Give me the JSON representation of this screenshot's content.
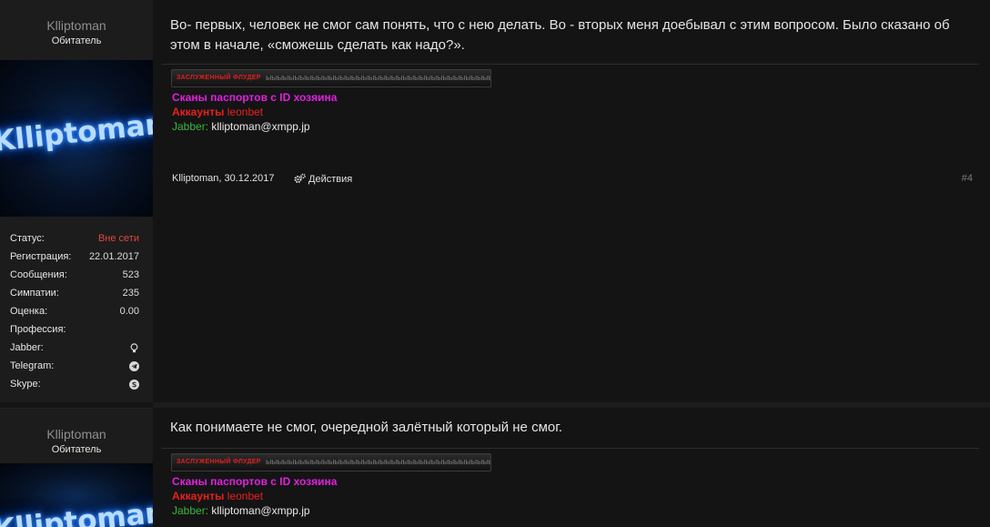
{
  "posts": [
    {
      "author": "Klliptoman",
      "user_title": "Обитатель",
      "avatar_text": "Klliptoman",
      "stats": [
        {
          "label": "Статус:",
          "value": "Вне сети"
        },
        {
          "label": "Регистрация:",
          "value": "22.01.2017"
        },
        {
          "label": "Сообщения:",
          "value": "523"
        },
        {
          "label": "Симпатии:",
          "value": "235"
        },
        {
          "label": "Оценка:",
          "value": "0.00"
        },
        {
          "label": "Профессия:",
          "value": ""
        },
        {
          "label": "Jabber:",
          "icon": "lightbulb-icon"
        },
        {
          "label": "Telegram:",
          "icon": "telegram-icon"
        },
        {
          "label": "Skype:",
          "icon": "skype-icon"
        }
      ],
      "message": "Во- первых, человек не смог сам понять, что с нею делать. Во - вторых меня доебывал с этим вопросом. Было сказано об этом в начале, «сможешь сделать как надо?».",
      "signature": {
        "banner_tag": "ЗАСЛУЖЕННЫЙ ФЛУДЕР",
        "banner_fill": "ыыыыыыыыыыыыыыыыыыыыыыыыыыыыыыыыыыыыыыыыыыыыыыы",
        "line1": "Сканы паспортов с ID хозяина",
        "line2_label": "Аккаунты",
        "line2_link": "leonbet",
        "line3_label": "Jabber:",
        "line3_value": "klliptoman@xmpp.jp"
      },
      "meta": {
        "author_date": "Klliptoman, 30.12.2017",
        "actions_label": "Действия",
        "post_number": "#4"
      }
    },
    {
      "author": "Klliptoman",
      "user_title": "Обитатель",
      "avatar_text": "Klliptoman",
      "message": "Как понимаете не смог, очередной залётный который не смог.",
      "signature": {
        "banner_tag": "ЗАСЛУЖЕННЫЙ ФЛУДЕР",
        "banner_fill": "ыыыыыыыыыыыыыыыыыыыыыыыыыыыыыыыыыыыыыыыыыыыыыыы",
        "line1": "Сканы паспортов с ID хозяина",
        "line2_label": "Аккаунты",
        "line2_link": "leonbet",
        "line3_label": "Jabber:",
        "line3_value": "klliptoman@xmpp.jp"
      }
    }
  ],
  "colors": {
    "background": "#141414",
    "sidebar": "#1c1c1c",
    "offline": "#e0463c",
    "signature_magenta": "#e020e0",
    "signature_red": "#e82020",
    "signature_green": "#3cb83c"
  }
}
